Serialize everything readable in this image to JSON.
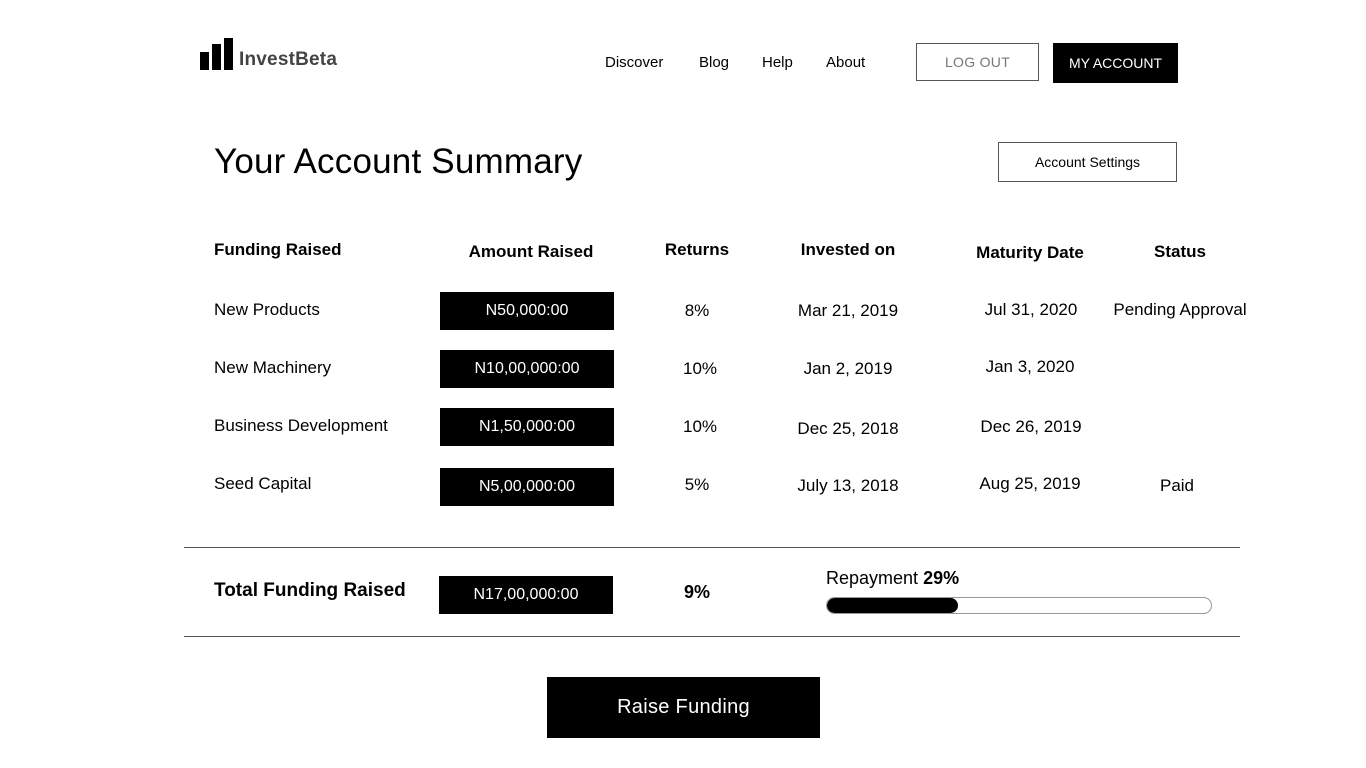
{
  "brand": {
    "name": "InvestBeta"
  },
  "nav": {
    "links": [
      "Discover",
      "Blog",
      "Help",
      "About"
    ],
    "logout_label": "LOG OUT",
    "account_label": "MY ACCOUNT"
  },
  "page": {
    "title": "Your Account Summary",
    "settings_label": "Account Settings"
  },
  "table": {
    "headers": [
      "Funding Raised",
      "Amount Raised",
      "Returns",
      "Invested on",
      "Maturity Date",
      "Status"
    ],
    "rows": [
      {
        "name": "New Products",
        "amount": "N50,000:00",
        "returns": "8%",
        "invested": "Mar 21, 2019",
        "maturity": "Jul 31, 2020",
        "status": "Pending Approval"
      },
      {
        "name": "New Machinery",
        "amount": "N10,00,000:00",
        "returns": "10%",
        "invested": "Jan 2, 2019",
        "maturity": "Jan 3, 2020",
        "status": ""
      },
      {
        "name": "Business Development",
        "amount": "N1,50,000:00",
        "returns": "10%",
        "invested": "Dec 25, 2018",
        "maturity": "Dec 26, 2019",
        "status": ""
      },
      {
        "name": "Seed Capital",
        "amount": "N5,00,000:00",
        "returns": "5%",
        "invested": "July 13, 2018",
        "maturity": "Aug 25, 2019",
        "status": "Paid"
      }
    ]
  },
  "totals": {
    "label": "Total Funding Raised",
    "amount": "N17,00,000:00",
    "returns": "9%",
    "repayment_label": "Repayment",
    "repayment_value": "29%",
    "repayment_fraction": 0.34
  },
  "actions": {
    "raise_label": "Raise Funding"
  },
  "colors": {
    "primary": "#000000",
    "background": "#ffffff",
    "muted": "#777777"
  }
}
